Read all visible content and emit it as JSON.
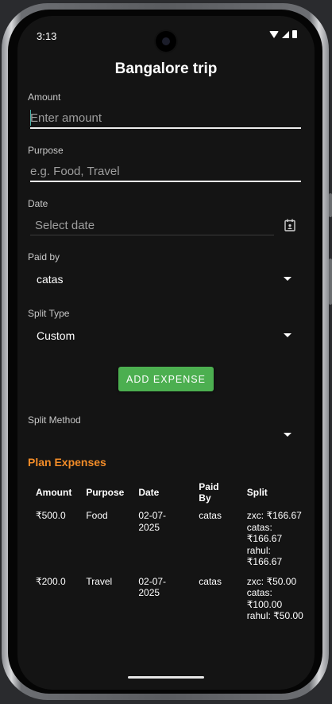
{
  "status_bar": {
    "time": "3:13"
  },
  "header": {
    "title": "Bangalore trip"
  },
  "form": {
    "amount": {
      "label": "Amount",
      "placeholder": "Enter amount"
    },
    "purpose": {
      "label": "Purpose",
      "placeholder": "e.g. Food, Travel"
    },
    "date": {
      "label": "Date",
      "placeholder": "Select date"
    },
    "paid_by": {
      "label": "Paid by",
      "value": "catas"
    },
    "split_type": {
      "label": "Split Type",
      "value": "Custom"
    },
    "add_button_label": "ADD EXPENSE",
    "split_method": {
      "label": "Split Method",
      "value": ""
    }
  },
  "expenses": {
    "section_title": "Plan Expenses",
    "columns": [
      "Amount",
      "Purpose",
      "Date",
      "Paid By",
      "Split"
    ],
    "rows": [
      {
        "amount": "₹500.0",
        "purpose": "Food",
        "date": "02-07-2025",
        "paid_by": "catas",
        "split": [
          "zxc: ₹166.67",
          "catas: ₹166.67",
          "rahul: ₹166.67"
        ]
      },
      {
        "amount": "₹200.0",
        "purpose": "Travel",
        "date": "02-07-2025",
        "paid_by": "catas",
        "split": [
          "zxc: ₹50.00",
          "catas: ₹100.00",
          "rahul: ₹50.00"
        ]
      }
    ]
  },
  "colors": {
    "accent_button": "#4caf50",
    "section_title": "#f28c28",
    "background": "#141414"
  }
}
